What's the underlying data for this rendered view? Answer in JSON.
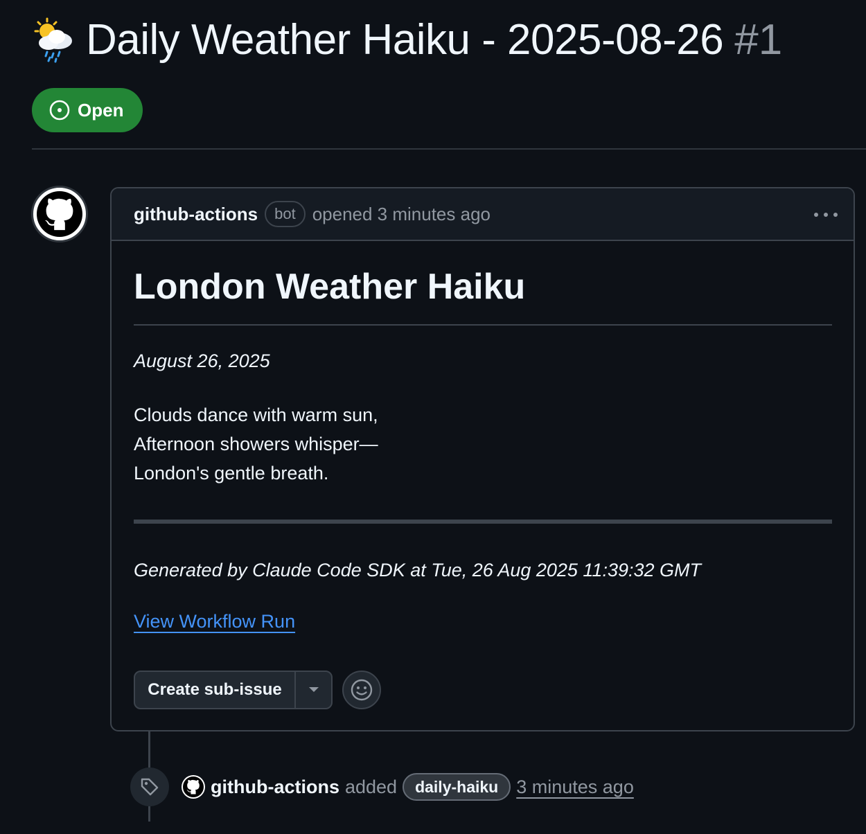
{
  "issue": {
    "title": "Daily Weather Haiku - 2025-08-26",
    "number": "#1",
    "title_emoji": "sun-behind-rain-cloud-icon",
    "state": "Open"
  },
  "comment": {
    "author": "github-actions",
    "author_badge": "bot",
    "opened_text": "opened 3 minutes ago",
    "heading": "London Weather Haiku",
    "date": "August 26, 2025",
    "haiku_lines": [
      "Clouds dance with warm sun,",
      "Afternoon showers whisper—",
      "London's gentle breath."
    ],
    "generated": "Generated by Claude Code SDK at Tue, 26 Aug 2025 11:39:32 GMT",
    "link_text": "View Workflow Run",
    "sub_issue_label": "Create sub-issue"
  },
  "timeline_event": {
    "author": "github-actions",
    "action": "added",
    "label": "daily-haiku",
    "time": "3 minutes ago"
  },
  "colors": {
    "background": "#0d1117",
    "open_green": "#238636",
    "link_blue": "#4493f8",
    "muted_text": "#9198a1",
    "border": "#3d444d"
  }
}
